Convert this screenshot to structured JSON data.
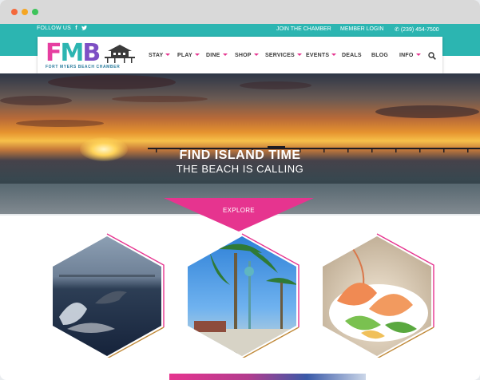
{
  "browser": {
    "controls": [
      "close",
      "minimize",
      "maximize"
    ]
  },
  "topbar": {
    "follow_label": "FOLLOW US",
    "social_icons": [
      "facebook-icon",
      "twitter-icon"
    ],
    "join_label": "JOIN THE CHAMBER",
    "login_label": "MEMBER LOGIN",
    "phone": "(239) 454-7500"
  },
  "logo": {
    "letters": [
      "F",
      "M",
      "B"
    ],
    "tagline": "FORT MYERS BEACH CHAMBER"
  },
  "nav": {
    "items": [
      {
        "label": "STAY",
        "dropdown": true
      },
      {
        "label": "PLAY",
        "dropdown": true
      },
      {
        "label": "DINE",
        "dropdown": true
      },
      {
        "label": "SHOP",
        "dropdown": true
      },
      {
        "label": "SERVICES",
        "dropdown": true
      },
      {
        "label": "EVENTS",
        "dropdown": true
      },
      {
        "label": "DEALS",
        "dropdown": false
      },
      {
        "label": "BLOG",
        "dropdown": false
      },
      {
        "label": "INFO",
        "dropdown": true
      }
    ],
    "search_icon": "search-icon"
  },
  "hero": {
    "title": "FIND ISLAND TIME",
    "subtitle": "THE BEACH IS CALLING",
    "explore_label": "EXPLORE"
  },
  "tiles": [
    {
      "name": "dolphin-tile",
      "subject": "dolphin jumping"
    },
    {
      "name": "palm-trees-tile",
      "subject": "palm trees and lamp post"
    },
    {
      "name": "shrimp-tile",
      "subject": "shrimp plate"
    }
  ],
  "colors": {
    "teal": "#2cb5b1",
    "pink": "#e6348f",
    "purple": "#7d4fc4"
  }
}
